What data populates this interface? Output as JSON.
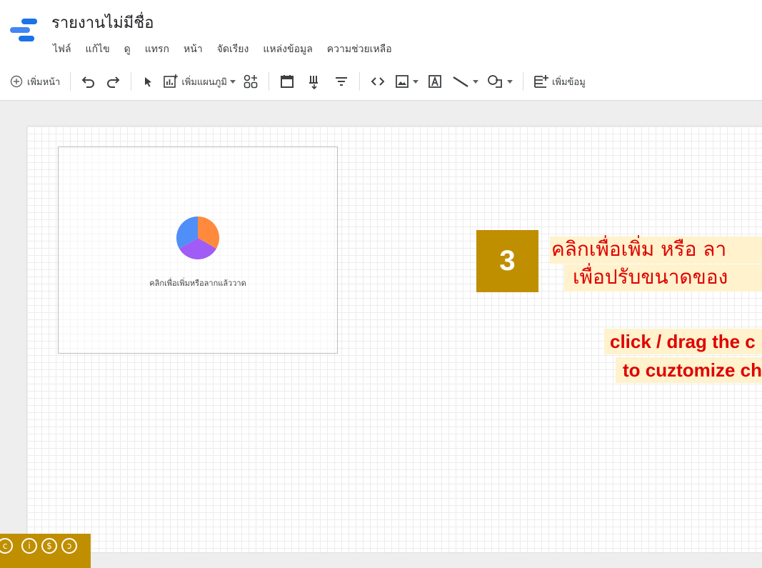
{
  "app": {
    "doc_title": "รายงานไม่มีชื่อ",
    "brand_color": "#1a73e8"
  },
  "menu": {
    "items": [
      {
        "label": "ไฟล์"
      },
      {
        "label": "แก้ไข"
      },
      {
        "label": "ดู"
      },
      {
        "label": "แทรก"
      },
      {
        "label": "หน้า"
      },
      {
        "label": "จัดเรียง"
      },
      {
        "label": "แหล่งข้อมูล"
      },
      {
        "label": "ความช่วยเหลือ"
      }
    ]
  },
  "toolbar": {
    "add_page_label": "เพิ่มหน้า",
    "add_chart_label": "เพิ่มแผนภูมิ",
    "add_data_label": "เพิ่มข้อมู",
    "icons": [
      "add-circle-icon",
      "undo-icon",
      "redo-icon",
      "select-pointer-icon",
      "add-chart-icon",
      "add-control-icon",
      "date-range-icon",
      "sort-icon",
      "filter-icon",
      "embed-code-icon",
      "image-icon",
      "text-box-icon",
      "line-icon",
      "shape-icon",
      "add-data-icon"
    ]
  },
  "canvas": {
    "placeholder_text": "คลิกเพื่อเพิ่มหรือลากแล้ววาด",
    "pie_colors": [
      "#ff8a3d",
      "#a15cf5",
      "#4f8ff7"
    ]
  },
  "annotation": {
    "step_number": "3",
    "thai_line1": "คลิกเพื่อเพิ่ม หรือ ลา",
    "thai_line2": "เพื่อปรับขนาดของ",
    "en_line1": "click / drag the c",
    "en_line2": "to cuztomize ch",
    "box_color": "#bf8f00",
    "text_color": "#e00000",
    "highlight_color": "#fff2cc"
  },
  "license_badge": {
    "icons": [
      "cc-icon",
      "by-icon",
      "nc-icon",
      "sa-icon"
    ],
    "glyphs": [
      "c",
      "i",
      "$",
      "ɔ"
    ]
  }
}
